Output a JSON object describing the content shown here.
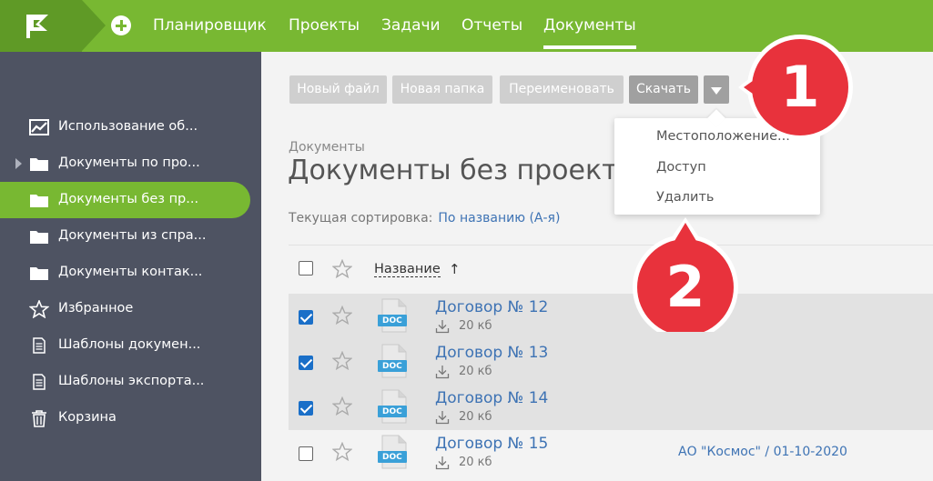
{
  "topnav": {
    "items": [
      "Планировщик",
      "Проекты",
      "Задачи",
      "Отчеты",
      "Документы"
    ],
    "active": "Документы"
  },
  "sidebar": {
    "items": [
      {
        "label": "Использование об...",
        "icon": "chart-icon"
      },
      {
        "label": "Документы по про...",
        "icon": "folder-icon",
        "expandable": true
      },
      {
        "label": "Документы без пр...",
        "icon": "folder-icon",
        "active": true
      },
      {
        "label": "Документы из спра...",
        "icon": "folder-icon"
      },
      {
        "label": "Документы контак...",
        "icon": "folder-icon"
      },
      {
        "label": "Избранное",
        "icon": "star-icon"
      },
      {
        "label": "Шаблоны докумен...",
        "icon": "document-icon"
      },
      {
        "label": "Шаблоны экспорта...",
        "icon": "document-icon"
      },
      {
        "label": "Корзина",
        "icon": "trash-icon"
      }
    ]
  },
  "toolbar": {
    "new_file": "Новый файл",
    "new_folder": "Новая папка",
    "rename": "Переименовать",
    "download": "Скачать"
  },
  "dropdown": {
    "items": [
      "Местоположение...",
      "Доступ",
      "Удалить"
    ]
  },
  "breadcrumb": "Документы",
  "page_title": "Документы без проекта",
  "sorting": {
    "label": "Текущая сортировка:",
    "value": "По названию (А-я)"
  },
  "table": {
    "column_name": "Название",
    "sort_arrow": "↑",
    "rows": [
      {
        "name": "Договор № 12",
        "size": "20 кб",
        "checked": true,
        "type": "DOC",
        "extra": ""
      },
      {
        "name": "Договор № 13",
        "size": "20 кб",
        "checked": true,
        "type": "DOC",
        "extra": ""
      },
      {
        "name": "Договор № 14",
        "size": "20 кб",
        "checked": true,
        "type": "DOC",
        "extra": ""
      },
      {
        "name": "Договор № 15",
        "size": "20 кб",
        "checked": false,
        "type": "DOC",
        "extra": "АО \"Космос\" / 01-10-2020"
      }
    ]
  },
  "callouts": [
    "1",
    "2"
  ],
  "colors": {
    "brand_green": "#78b832",
    "sidebar_bg": "#4e5362",
    "link_blue": "#3e73b4",
    "callout_red": "#e8323c",
    "doc_badge": "#3aa0d8"
  }
}
